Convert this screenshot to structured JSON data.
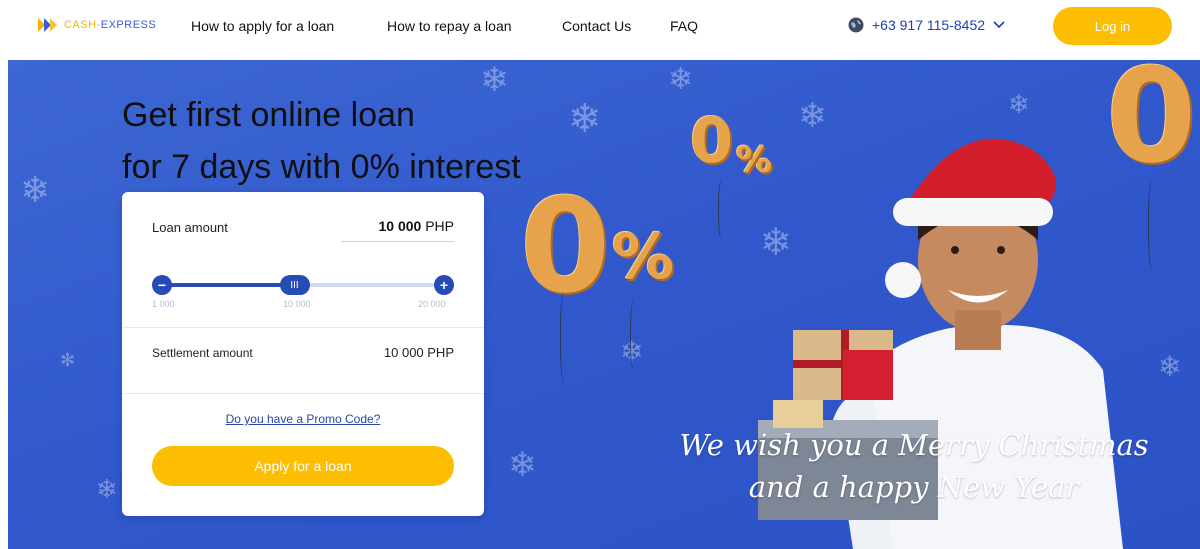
{
  "header": {
    "logo": {
      "part1": "CASH",
      "separator": "-",
      "part2": "EXPRESS"
    },
    "nav": [
      "How to apply for a loan",
      "How to repay a loan",
      "Contact Us",
      "FAQ"
    ],
    "phone": "+63 917 115-8452",
    "login_label": "Log in"
  },
  "hero": {
    "headline_line1": "Get first online loan",
    "headline_line2": "for 7 days with 0% interest",
    "wish_line1": "We wish you a Merry Christmas",
    "wish_line2": "and a happy New Year",
    "balloon_zero": "0",
    "balloon_percent": "%"
  },
  "loan_card": {
    "loan_amount_label": "Loan amount",
    "loan_amount_value": "10 000",
    "currency": "PHP",
    "slider": {
      "min_label": "1 000",
      "mid_label": "10 000",
      "max_label": "20 000",
      "value_fraction": 0.47,
      "minus": "−",
      "plus": "+",
      "thumb_glyph": "III"
    },
    "settlement_label": "Settlement amount",
    "settlement_value": "10 000 PHP",
    "promo_link": "Do you have a Promo Code?",
    "apply_label": "Apply for a loan"
  },
  "colors": {
    "accent_yellow": "#fdbd00",
    "brand_blue": "#274bb4",
    "hero_blue": "#3159cc"
  },
  "icons": [
    "logo-icon",
    "globe-icon",
    "chevron-down-icon",
    "minus-icon",
    "plus-icon",
    "slider-thumb-icon"
  ]
}
